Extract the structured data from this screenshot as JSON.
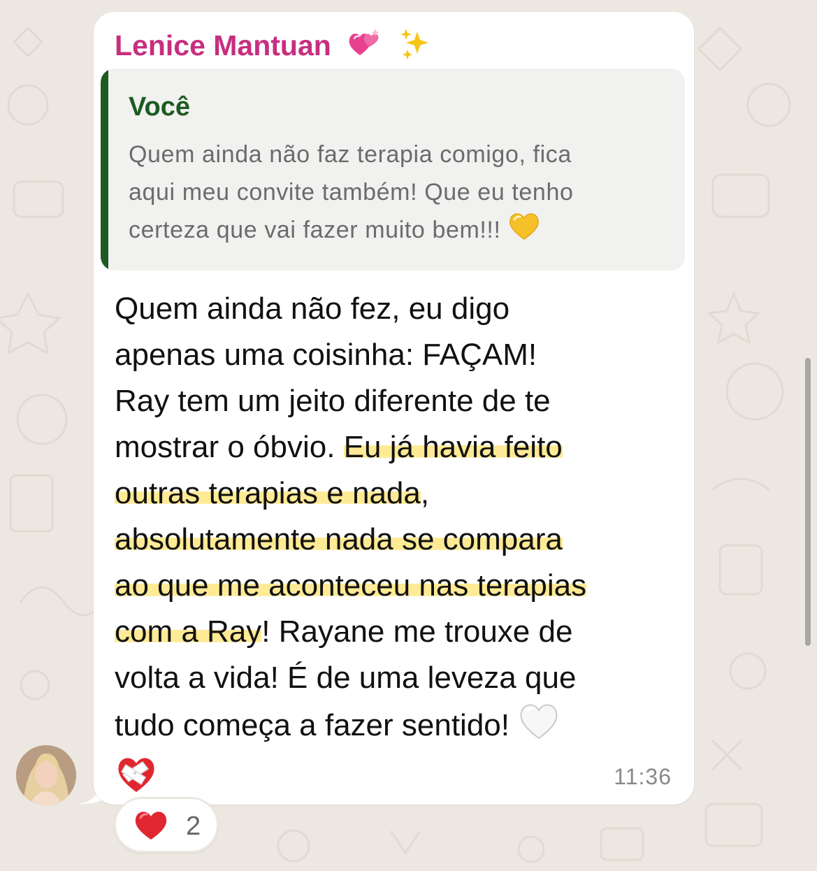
{
  "chat": {
    "sender_name": "Lenice Mantuan",
    "sender_emojis": [
      "sparkling-heart-icon",
      "sparkles-icon"
    ],
    "quoted": {
      "author": "Você",
      "text_lines": [
        "Quem ainda não faz terapia comigo, fica",
        "aqui meu convite também! Que eu tenho",
        "certeza que vai fazer muito bem!!!"
      ],
      "emoji": "yellow-heart-icon"
    },
    "message": {
      "lines": [
        "Quem ainda não fez, eu digo",
        "apenas uma coisinha: FAÇAM!",
        "Ray tem um jeito diferente de te",
        "mostrar o óbvio. ",
        "Eu já havia feito",
        "outras terapias e nada",
        ",",
        "absolutamente nada se compara",
        "ao que me aconteceu nas terapias",
        "com a Ray",
        "! Rayane me trouxe de",
        "volta a vida! É de uma leveza que",
        "tudo começa a fazer sentido!"
      ],
      "trailing_emojis": [
        "white-heart-icon",
        "mending-heart-icon"
      ],
      "highlight_color": "#ffe682"
    },
    "time": "11:36",
    "reaction": {
      "emoji": "red-heart-icon",
      "count": "2"
    }
  },
  "colors": {
    "background": "#ece8e1",
    "bubble": "#ffffff",
    "sender_name": "#c72e7f",
    "quote_accent": "#1d5b22",
    "quote_text": "#6b6b6b",
    "timestamp": "#8a8a8a"
  }
}
